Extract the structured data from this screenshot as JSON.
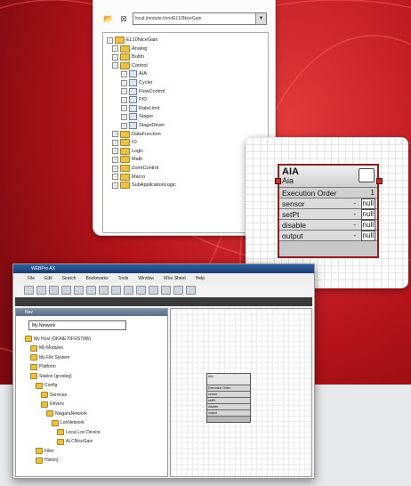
{
  "tree_panel": {
    "location_combo": "local:|module://nre/EL10NiceGain",
    "items": [
      {
        "label": "EL10NiceGain",
        "icon": "folder-icon",
        "expanded": true
      },
      {
        "label": "Analog",
        "icon": "folder-icon"
      },
      {
        "label": "BultIn",
        "icon": "folder-icon"
      },
      {
        "label": "Control",
        "icon": "folder-icon",
        "expanded": true
      },
      {
        "label": "AIA",
        "icon": "block-icon"
      },
      {
        "label": "Cycler",
        "icon": "block-icon"
      },
      {
        "label": "FlowControl",
        "icon": "block-icon"
      },
      {
        "label": "PID",
        "icon": "block-icon"
      },
      {
        "label": "RateLimit",
        "icon": "block-icon"
      },
      {
        "label": "Stager",
        "icon": "block-icon"
      },
      {
        "label": "StageDriver",
        "icon": "block-icon"
      },
      {
        "label": "DataFunction",
        "icon": "folder-icon"
      },
      {
        "label": "IO",
        "icon": "folder-icon"
      },
      {
        "label": "Logic",
        "icon": "folder-icon"
      },
      {
        "label": "Math",
        "icon": "folder-icon"
      },
      {
        "label": "ZoneControl",
        "icon": "folder-icon"
      },
      {
        "label": "Macro",
        "icon": "folder-icon"
      },
      {
        "label": "SubApplicationLogic",
        "icon": "folder-icon"
      }
    ]
  },
  "aia_block": {
    "title": "AIA",
    "subtitle": "Aia",
    "exec_label": "Execution Order",
    "exec_value": "1",
    "slots": [
      {
        "name": "sensor",
        "value": "null"
      },
      {
        "name": "setPt",
        "value": "null"
      },
      {
        "name": "disable",
        "value": "null"
      },
      {
        "name": "output",
        "value": "null"
      }
    ]
  },
  "app_window": {
    "title": "WEBPro AX",
    "menu": [
      "File",
      "Edit",
      "Search",
      "Bookmarks",
      "Tools",
      "Window",
      "Wire Sheet",
      "Help"
    ],
    "nav_header": "Nav",
    "nav_combo": "My Network",
    "nav_items": [
      "My Host (DKAIE70FOS79W)",
      "My Modules",
      "My File System",
      "Platform",
      "Station (grosleg)",
      "Config",
      "Services",
      "Drivers",
      "NiagaraNetwork",
      "LonNetwork",
      "Local Lon Device",
      "ALCNiceGain",
      "Files",
      "History"
    ],
    "mini_block": {
      "title": "AIA",
      "subtitle": "Aia",
      "rows": [
        "Execution Order",
        "sensor",
        "setPt",
        "disable",
        "output"
      ]
    }
  }
}
